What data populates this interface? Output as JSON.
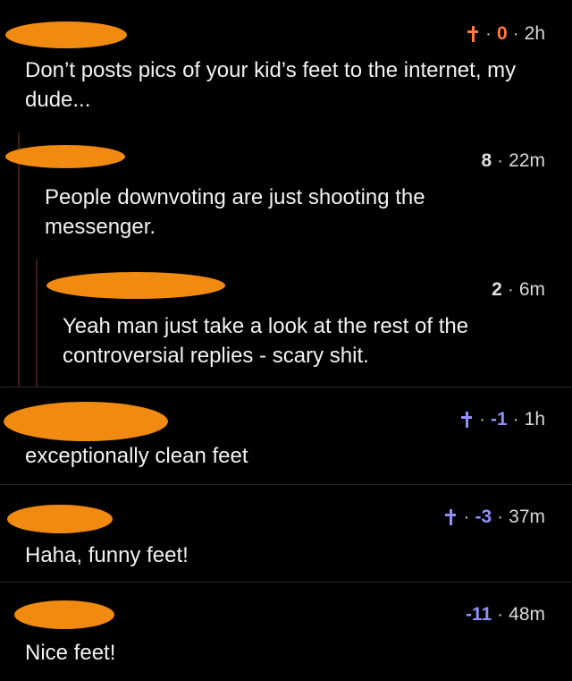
{
  "colors": {
    "background": "#000000",
    "redaction": "#f08a10",
    "controversial_marker": "#ff7a3d",
    "downvote_score": "#8f8fff",
    "text": "#f2f2f2"
  },
  "comments": [
    {
      "author_redacted": true,
      "controversial_icon": "cross-icon",
      "score": "0",
      "separator": "·",
      "time": "2h",
      "text": "Don’t posts pics of your kid’s feet to the internet, my dude..."
    },
    {
      "author_redacted": true,
      "score": "8",
      "separator": "·",
      "time": "22m",
      "text": "People downvoting are just shooting the messenger."
    },
    {
      "author_redacted": true,
      "score": "2",
      "separator": "·",
      "time": "6m",
      "text": "Yeah man just take a look at the rest of the controversial replies - scary shit."
    },
    {
      "author_redacted": true,
      "controversial_icon": "cross-icon",
      "score": "-1",
      "separator": "·",
      "time": "1h",
      "text": "exceptionally clean feet"
    },
    {
      "author_redacted": true,
      "controversial_icon": "cross-icon",
      "score": "-3",
      "separator": "·",
      "time": "37m",
      "text": "Haha, funny feet!"
    },
    {
      "author_redacted": true,
      "score": "-11",
      "separator": "·",
      "time": "48m",
      "text": "Nice feet!"
    }
  ]
}
